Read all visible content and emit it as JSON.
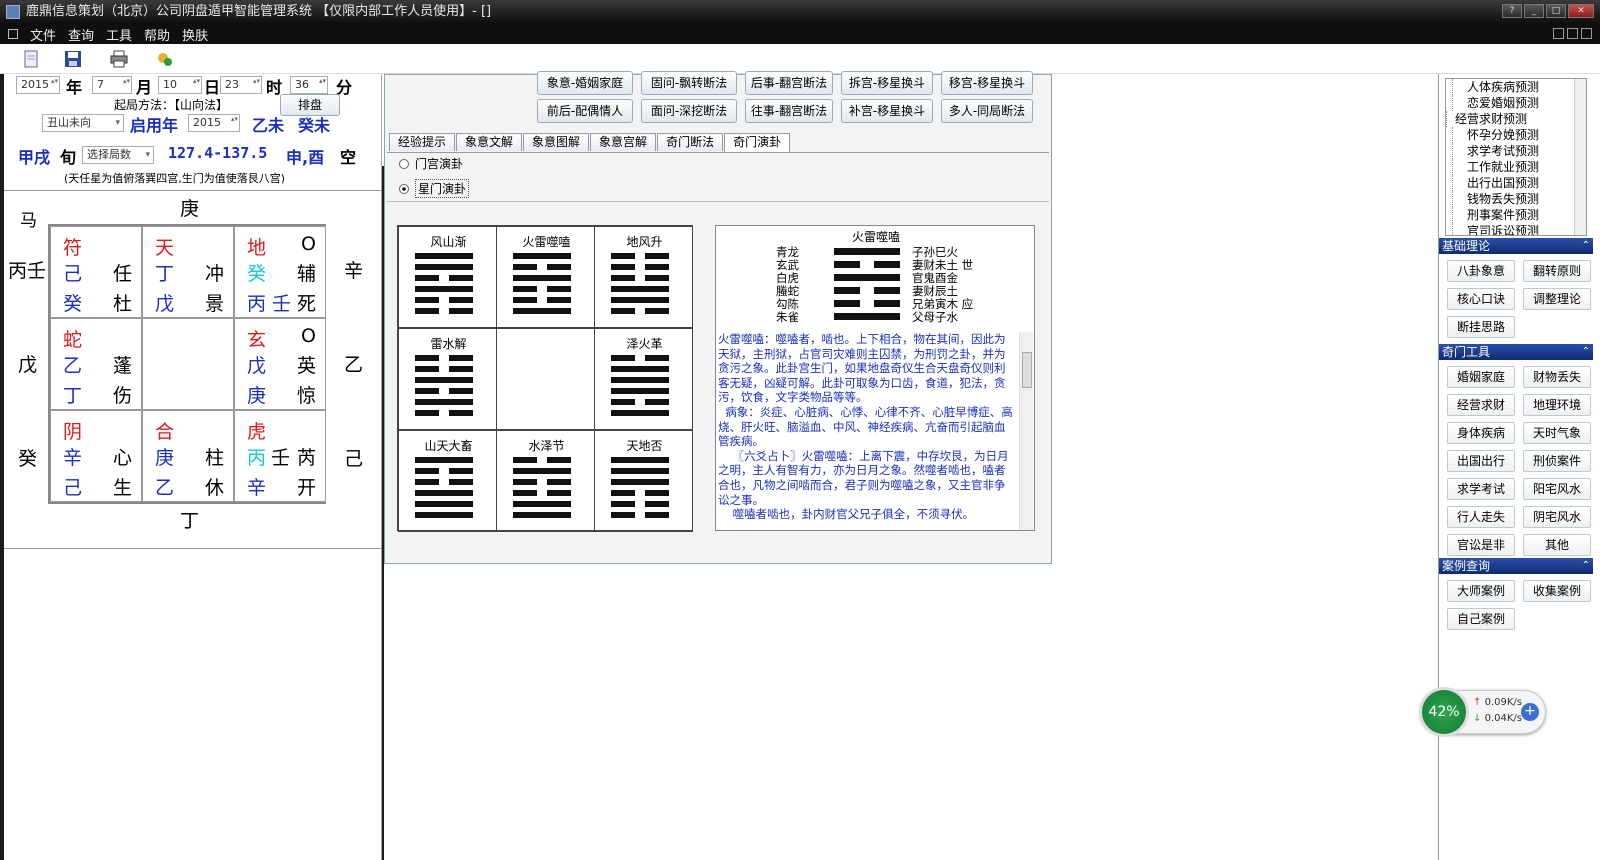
{
  "window": {
    "title": "鹿鼎信息策划（北京）公司阴盘遁甲智能管理系统 【仅限内部工作人员使用】- []"
  },
  "menu": [
    "文件",
    "查询",
    "工具",
    "帮助",
    "换肤"
  ],
  "toolbar_icons": [
    "new-icon",
    "save-icon",
    "print-icon",
    "settings-icon"
  ],
  "date": {
    "year": "2015",
    "year_label": "年",
    "month": "7",
    "month_label": "月",
    "day": "10",
    "day_label": "日",
    "hour": "23",
    "hour_label": "时",
    "minute": "36",
    "minute_label": "分"
  },
  "method": {
    "label": "起局方法：【山向法】",
    "button": "排盘"
  },
  "mountain": {
    "value": "丑山未向",
    "qiyong_label": "启用年",
    "qiyong_year": "2015",
    "ganzhi1": "乙未",
    "ganzhi2": "癸未"
  },
  "xun": {
    "name": "甲戌",
    "label": "旬",
    "select": "选择局数",
    "range": "127.4-137.5",
    "kong": "申,酉",
    "kong_label": "空"
  },
  "note": "(天任星为值俯落巽四宫,生门为值使落艮八宫)",
  "chart": {
    "ma": "马",
    "top": "庚",
    "bottom": "丁",
    "left": [
      "丙壬",
      "戊",
      "癸"
    ],
    "right": [
      "辛",
      "乙",
      "己"
    ],
    "cells": [
      {
        "god": "符",
        "gan1": "己",
        "star": "任",
        "gan2": "癸",
        "door": "杜"
      },
      {
        "god": "天",
        "gan1": "丁",
        "star": "冲",
        "gan2": "戊",
        "door": "景"
      },
      {
        "god": "地",
        "mark": "O",
        "gan1": "癸",
        "star": "辅",
        "gan2": "丙 壬",
        "door": "死"
      },
      {
        "god": "蛇",
        "gan1": "乙",
        "star": "蓬",
        "gan2": "丁",
        "door": "伤"
      },
      {},
      {
        "god": "玄",
        "mark": "O",
        "gan1": "戊",
        "star": "英",
        "gan2": "庚",
        "door": "惊"
      },
      {
        "god": "阴",
        "gan1": "辛",
        "star": "心",
        "gan2": "己",
        "door": "生"
      },
      {
        "god": "合",
        "gan1": "庚",
        "star": "柱",
        "gan2": "乙",
        "door": "休"
      },
      {
        "god": "虎",
        "gan1": "丙",
        "gan1b": "壬",
        "star": "芮",
        "gan2": "辛",
        "door": "开"
      }
    ]
  },
  "method_buttons": [
    [
      "象意-婚姻家庭",
      "固问-飘转断法",
      "后事-翻宫断法",
      "拆宫-移星换斗",
      "移宫-移星换斗"
    ],
    [
      "前后-配偶情人",
      "面问-深挖断法",
      "往事-翻宫断法",
      "补宫-移星换斗",
      "多人-同局断法"
    ]
  ],
  "tabs": [
    "经验提示",
    "象意文解",
    "象意图解",
    "象意宫解",
    "奇门断法",
    "奇门演卦"
  ],
  "radios": [
    {
      "label": "门宫演卦",
      "checked": false
    },
    {
      "label": "星门演卦",
      "checked": true
    }
  ],
  "hexagrams": [
    {
      "name": "风山渐",
      "lines": [
        1,
        1,
        0,
        1,
        0,
        0
      ]
    },
    {
      "name": "火雷噬嗑",
      "lines": [
        1,
        0,
        1,
        0,
        0,
        1
      ]
    },
    {
      "name": "地风升",
      "lines": [
        0,
        0,
        0,
        1,
        1,
        0
      ]
    },
    {
      "name": "雷水解",
      "lines": [
        0,
        0,
        1,
        0,
        1,
        0
      ]
    },
    {
      "name": "",
      "lines": []
    },
    {
      "name": "泽火革",
      "lines": [
        0,
        1,
        1,
        1,
        0,
        1
      ]
    },
    {
      "name": "山天大畜",
      "lines": [
        1,
        0,
        0,
        1,
        1,
        1
      ]
    },
    {
      "name": "水泽节",
      "lines": [
        0,
        1,
        0,
        0,
        1,
        1
      ]
    },
    {
      "name": "天地否",
      "lines": [
        1,
        1,
        1,
        0,
        0,
        0
      ]
    }
  ],
  "detail": {
    "title": "火雷噬嗑",
    "rows": [
      {
        "god": "青龙",
        "line": 1,
        "info": "子孙巳火"
      },
      {
        "god": "玄武",
        "line": 0,
        "info": "妻财未土 世"
      },
      {
        "god": "白虎",
        "line": 1,
        "info": "官鬼酉金"
      },
      {
        "god": "螣蛇",
        "line": 0,
        "info": "妻财辰土"
      },
      {
        "god": "勾陈",
        "line": 0,
        "info": "兄弟寅木 应"
      },
      {
        "god": "朱雀",
        "line": 1,
        "info": "父母子水"
      }
    ],
    "text": "火雷噬嗑：噬嗑者，啮也。上下相合，物在其间，因此为天狱，主刑狱，占官司灾难则主囚禁，为刑罚之卦，并为贪污之象。此卦宫生门，如果地盘奇仪生合天盘奇仪则利客无疑，凶疑可解。此卦可取象为口齿，食道，犯法，贪污，饮食，文字类物品等等。\n  病象：炎症、心脏病、心悸、心律不齐、心脏早博症、高烧、肝火旺、脑溢血、中风、神经疾病、亢奋而引起脑血管疾病。\n    〖六爻占卜〗火雷噬嗑：上离下震，中存坎艮，为日月之明，主人有智有力，亦为日月之象。然噬者啮也，嗑者合也，凡物之间啮而合，君子则为噬嗑之象，又主官非争讼之事。\n    噬嗑者啮也，卦内财官父兄子俱全，不须寻伏。"
  },
  "right": {
    "tree": [
      "人体疾病预测",
      "恋爱婚姻预测",
      "经营求财预测",
      "怀孕分娩预测",
      "求学考试预测",
      "工作就业预测",
      "出行出国预测",
      "钱物丢失预测",
      "刑事案件预测",
      "官司诉讼预测"
    ],
    "sections": [
      {
        "title": "基础理论",
        "buttons": [
          "八卦象意",
          "翻转原则",
          "核心口诀",
          "调整理论",
          "断挂思路"
        ]
      },
      {
        "title": "奇门工具",
        "buttons": [
          "婚姻家庭",
          "财物丢失",
          "经营求财",
          "地理环境",
          "身体疾病",
          "天时气象",
          "出国出行",
          "刑侦案件",
          "求学考试",
          "阳宅风水",
          "行人走失",
          "阴宅风水",
          "官讼是非",
          "其他"
        ]
      },
      {
        "title": "案例查询",
        "buttons": [
          "大师案例",
          "收集案例",
          "自己案例"
        ]
      }
    ]
  },
  "widget": {
    "percent": "42%",
    "up": "0.09K/s",
    "down": "0.04K/s"
  },
  "colors": {
    "god_red": "#e2191a",
    "stem_blue": "#1a2fbf",
    "cyan": "#19c6d8",
    "section_blue": "#1d3b8f"
  }
}
